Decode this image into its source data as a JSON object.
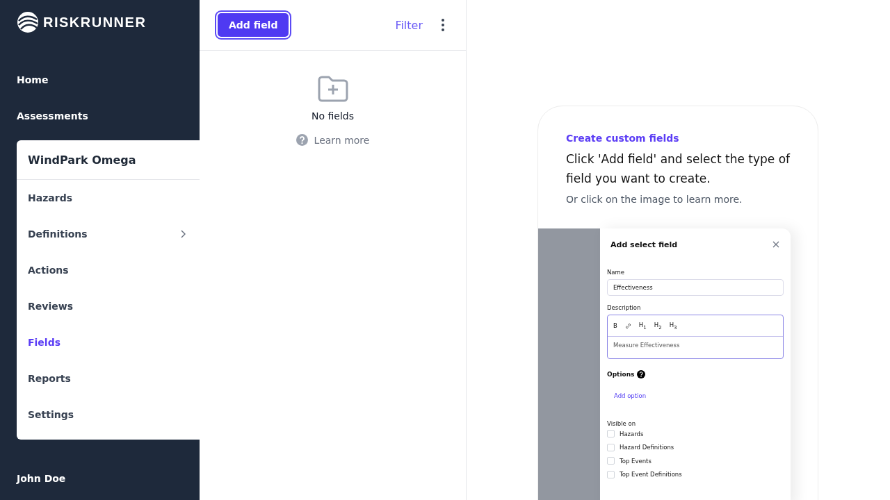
{
  "sidebar": {
    "logo": "RISKRUNNER",
    "top_items": [
      {
        "label": "Home"
      },
      {
        "label": "Assessments"
      }
    ],
    "project": {
      "title": "WindPark Omega",
      "items": [
        {
          "label": "Hazards",
          "selected": false,
          "has_submenu": false
        },
        {
          "label": "Definitions",
          "selected": false,
          "has_submenu": true
        },
        {
          "label": "Actions",
          "selected": false,
          "has_submenu": false
        },
        {
          "label": "Reviews",
          "selected": false,
          "has_submenu": false
        },
        {
          "label": "Fields",
          "selected": true,
          "has_submenu": false
        },
        {
          "label": "Reports",
          "selected": false,
          "has_submenu": false
        },
        {
          "label": "Settings",
          "selected": false,
          "has_submenu": false
        }
      ]
    },
    "user": "John Doe"
  },
  "toolbar": {
    "add_button": "Add field",
    "filter": "Filter"
  },
  "empty_state": {
    "title": "No fields",
    "link": "Learn more"
  },
  "help_card": {
    "eyebrow": "Create custom fields",
    "heading": "Click 'Add field' and select the type of field you want to create.",
    "subtext": "Or click on the image to learn more.",
    "preview": {
      "title": "Add select field",
      "name_label": "Name",
      "name_value": "Effectiveness",
      "description_label": "Description",
      "format_buttons": [
        "B",
        "H$_{1}$",
        "H$_{2}$",
        "H$_{3}$"
      ],
      "description_value": "Measure Effectiveness",
      "options_label": "Options",
      "add_option": "Add option",
      "visible_label": "Visible on",
      "visible_on": [
        {
          "label": "Hazards",
          "checked": false
        },
        {
          "label": "Hazard Definitions",
          "checked": false
        },
        {
          "label": "Top Events",
          "checked": false
        },
        {
          "label": "Top Event Definitions",
          "checked": false
        }
      ]
    }
  }
}
